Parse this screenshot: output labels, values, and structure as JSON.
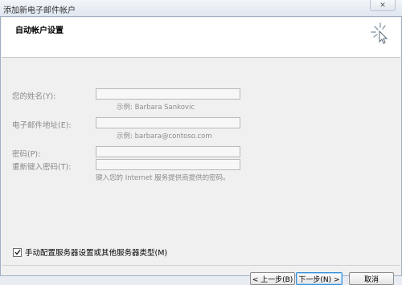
{
  "window": {
    "title": "添加新电子邮件帐户",
    "close_icon": "close-icon"
  },
  "header": {
    "heading": "自动帐户设置"
  },
  "form": {
    "name": {
      "label": "您的姓名(Y):",
      "value": "",
      "hint": "示例: Barbara Sankovic"
    },
    "email": {
      "label": "电子邮件地址(E):",
      "value": "",
      "hint": "示例: barbara@contoso.com"
    },
    "password": {
      "label": "密码(P):",
      "value": ""
    },
    "retype": {
      "label": "重新键入密码(T):",
      "value": "",
      "hint": "键入您的 Internet 服务提供商提供的密码。"
    }
  },
  "manual_config": {
    "label": "手动配置服务器设置或其他服务器类型(M)",
    "checked": true
  },
  "buttons": {
    "back": "< 上一步(B)",
    "next": "下一步(N) >",
    "cancel": "取消"
  }
}
